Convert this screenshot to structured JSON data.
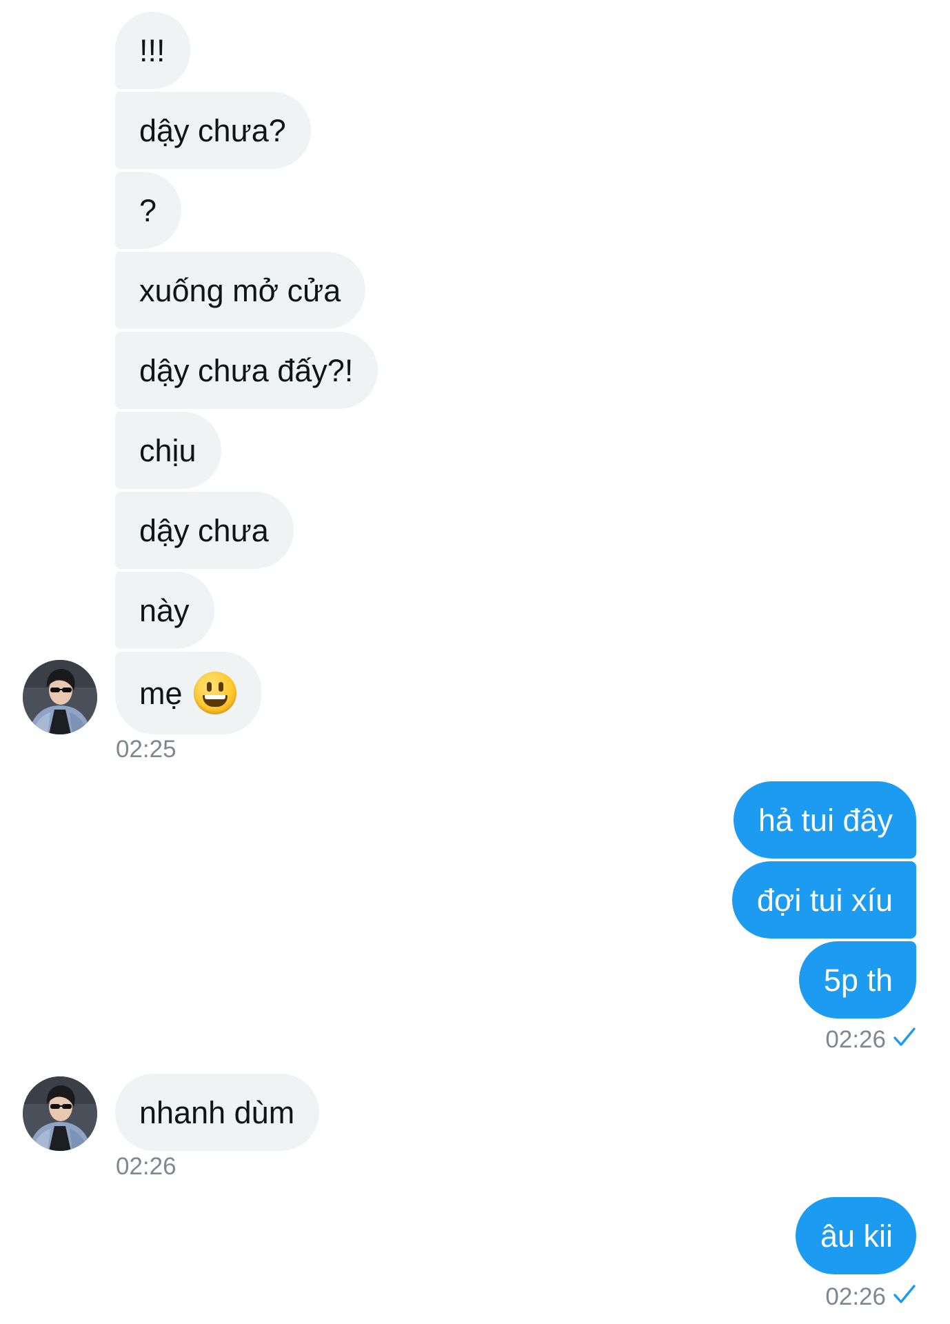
{
  "received_group_1": {
    "messages": [
      "!!!",
      "dậy chưa?",
      "?",
      "xuống mở cửa",
      "dậy chưa đấy?!",
      "chịu",
      "dậy chưa",
      "này",
      "mẹ"
    ],
    "last_emoji": "smiley-emoji",
    "time": "02:25"
  },
  "sent_group_1": {
    "messages": [
      "hả tui đây",
      "đợi tui xíu",
      "5p th"
    ],
    "time": "02:26",
    "status_icon": "sent-check-icon"
  },
  "received_group_2": {
    "messages": [
      "nhanh dùm"
    ],
    "time": "02:26"
  },
  "sent_group_2": {
    "messages": [
      "âu kii"
    ],
    "time": "02:26",
    "status_icon": "sent-check-icon"
  },
  "colors": {
    "incoming_bubble": "#eff3f4",
    "outgoing_bubble": "#1d9bf0",
    "timestamp": "#7e8790",
    "check": "#1d9bf0"
  }
}
